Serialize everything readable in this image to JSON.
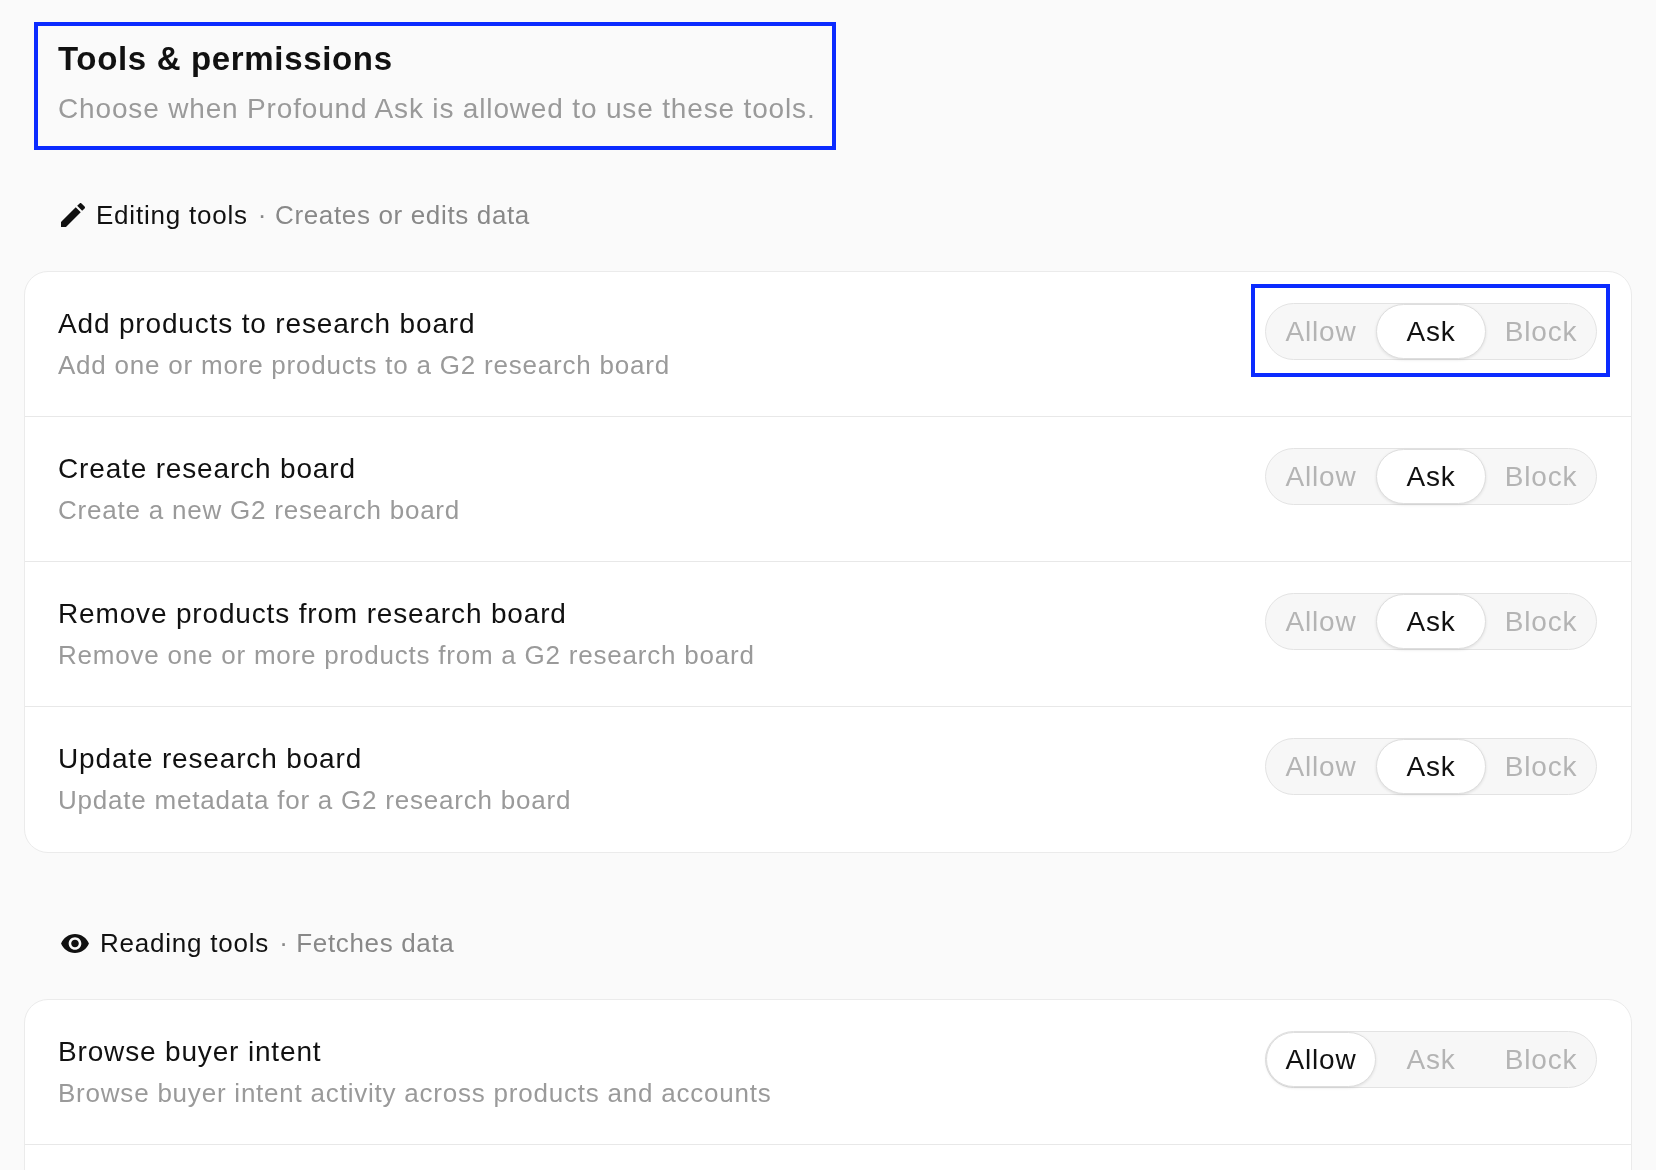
{
  "header": {
    "title": "Tools & permissions",
    "subtitle": "Choose when Profound Ask is allowed to use these tools.",
    "highlighted": true
  },
  "sections": [
    {
      "kind": "editing",
      "title": "Editing tools",
      "description": "· Creates or edits data",
      "tools": [
        {
          "name": "Add products to research board",
          "description": "Add one or more products to a G2 research board",
          "highlighted": true,
          "options": [
            {
              "label": "Allow",
              "selected": false
            },
            {
              "label": "Ask",
              "selected": true
            },
            {
              "label": "Block",
              "selected": false
            }
          ]
        },
        {
          "name": "Create research board",
          "description": "Create a new G2 research board",
          "highlighted": false,
          "options": [
            {
              "label": "Allow",
              "selected": false
            },
            {
              "label": "Ask",
              "selected": true
            },
            {
              "label": "Block",
              "selected": false
            }
          ]
        },
        {
          "name": "Remove products from research board",
          "description": "Remove one or more products from a G2 research board",
          "highlighted": false,
          "options": [
            {
              "label": "Allow",
              "selected": false
            },
            {
              "label": "Ask",
              "selected": true
            },
            {
              "label": "Block",
              "selected": false
            }
          ]
        },
        {
          "name": "Update research board",
          "description": "Update metadata for a G2 research board",
          "highlighted": false,
          "options": [
            {
              "label": "Allow",
              "selected": false
            },
            {
              "label": "Ask",
              "selected": true
            },
            {
              "label": "Block",
              "selected": false
            }
          ]
        }
      ]
    },
    {
      "kind": "reading",
      "title": "Reading tools",
      "description": "· Fetches data",
      "tools": [
        {
          "name": "Browse buyer intent",
          "description": "Browse buyer intent activity across products and accounts",
          "highlighted": false,
          "options": [
            {
              "label": "Allow",
              "selected": true
            },
            {
              "label": "Ask",
              "selected": false
            },
            {
              "label": "Block",
              "selected": false
            }
          ]
        }
      ]
    }
  ]
}
